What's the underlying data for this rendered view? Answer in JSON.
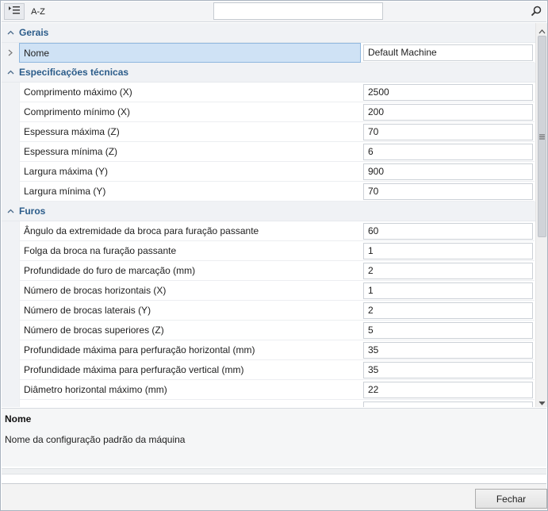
{
  "toolbar": {
    "categorized_icon": "categorized-list-icon",
    "alphabetical_label": "A-Z",
    "search_value": "",
    "search_icon": "search-icon"
  },
  "grid": {
    "categories": [
      {
        "label": "Gerais",
        "properties": [
          {
            "name": "Nome",
            "value": "Default Machine",
            "selected": true
          }
        ]
      },
      {
        "label": "Especificações técnicas",
        "properties": [
          {
            "name": "Comprimento máximo (X)",
            "value": "2500"
          },
          {
            "name": "Comprimento mínimo (X)",
            "value": "200"
          },
          {
            "name": "Espessura máxima (Z)",
            "value": "70"
          },
          {
            "name": "Espessura mínima (Z)",
            "value": "6"
          },
          {
            "name": "Largura máxima (Y)",
            "value": "900"
          },
          {
            "name": "Largura mínima (Y)",
            "value": "70"
          }
        ]
      },
      {
        "label": "Furos",
        "properties": [
          {
            "name": "Ângulo da extremidade da broca para furação passante",
            "value": "60"
          },
          {
            "name": "Folga da broca na furação passante",
            "value": "1"
          },
          {
            "name": "Profundidade do furo de marcação (mm)",
            "value": "2"
          },
          {
            "name": "Número de brocas horizontais (X)",
            "value": "1"
          },
          {
            "name": "Número de brocas laterais (Y)",
            "value": "2"
          },
          {
            "name": "Número de brocas superiores (Z)",
            "value": "5"
          },
          {
            "name": "Profundidade máxima para perfuração horizontal (mm)",
            "value": "35"
          },
          {
            "name": "Profundidade máxima para perfuração vertical (mm)",
            "value": "35"
          },
          {
            "name": "Diâmetro horizontal máximo (mm)",
            "value": "22"
          },
          {
            "name": "",
            "value": ""
          }
        ]
      }
    ]
  },
  "description": {
    "title": "Nome",
    "text": "Nome da configuração padrão da máquina"
  },
  "footer": {
    "close_label": "Fechar"
  }
}
